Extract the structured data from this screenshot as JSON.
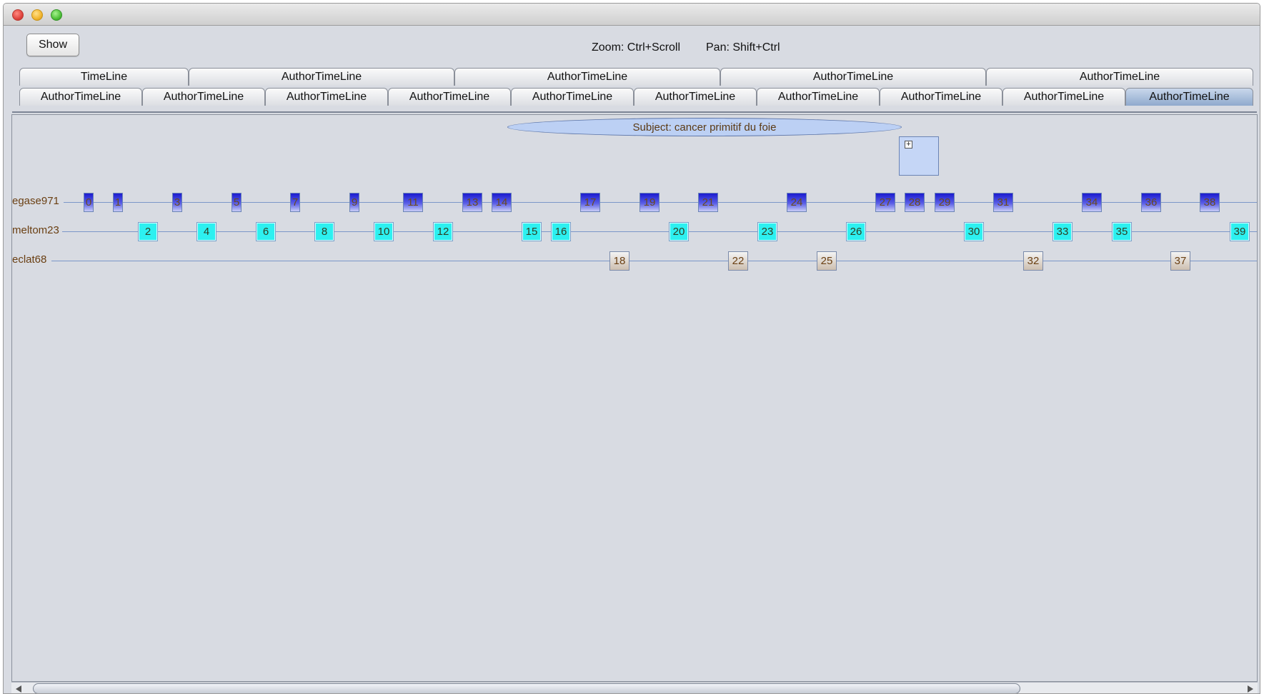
{
  "toolbar": {
    "show_label": "Show",
    "zoom_hint": "Zoom: Ctrl+Scroll",
    "pan_hint": "Pan: Shift+Ctrl"
  },
  "tabs": {
    "row1": [
      "TimeLine",
      "AuthorTimeLine",
      "AuthorTimeLine",
      "AuthorTimeLine",
      "AuthorTimeLine"
    ],
    "row2": [
      "AuthorTimeLine",
      "AuthorTimeLine",
      "AuthorTimeLine",
      "AuthorTimeLine",
      "AuthorTimeLine",
      "AuthorTimeLine",
      "AuthorTimeLine",
      "AuthorTimeLine",
      "AuthorTimeLine",
      "AuthorTimeLine"
    ],
    "active": "row2-9"
  },
  "timeline": {
    "subject": "Subject: cancer primitif du foie",
    "authors": [
      {
        "name": "egase971",
        "color": "#2020d8",
        "messages": [
          "0",
          "1",
          "3",
          "5",
          "7",
          "9",
          "11",
          "13",
          "14",
          "17",
          "19",
          "21",
          "24",
          "27",
          "28",
          "29",
          "31",
          "34",
          "36",
          "38"
        ]
      },
      {
        "name": "meltom23",
        "color": "#2df0f0",
        "messages": [
          "2",
          "4",
          "6",
          "8",
          "10",
          "12",
          "15",
          "16",
          "20",
          "23",
          "26",
          "30",
          "33",
          "35",
          "39"
        ]
      },
      {
        "name": "eclat68",
        "color": "#d9cfc4",
        "messages": [
          "18",
          "22",
          "25",
          "32",
          "37"
        ]
      }
    ]
  }
}
